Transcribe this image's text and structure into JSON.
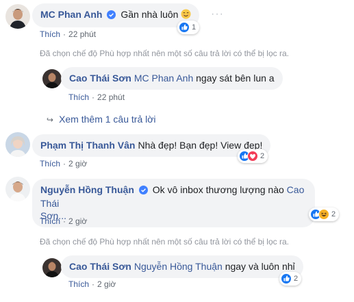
{
  "comments": [
    {
      "author": "MC Phan Anh",
      "verified": true,
      "text": "Gần nhà luôn",
      "emoji": "😊",
      "like_label": "Thích",
      "time": "22 phút",
      "reaction_count": "1"
    },
    {
      "author": "Phạm Thị Thanh Vân",
      "text": "Nhà đẹp! Bạn đẹp! View đẹp!",
      "like_label": "Thích",
      "time": "2 giờ",
      "reaction_count": "2"
    },
    {
      "author": "Nguyễn Hồng Thuận",
      "verified": true,
      "text_line1": "Ok vô inbox thương lượng nào",
      "mention_line1": "Cao Thái",
      "mention_line2": "Sơn...",
      "like_label": "Thích",
      "time": "2 giờ",
      "reaction_count": "2"
    }
  ],
  "replies": [
    {
      "author": "Cao Thái Sơn",
      "mention": "MC Phan Anh",
      "text": "ngay sát bên lun a",
      "like_label": "Thích",
      "time": "22 phút"
    },
    {
      "author": "Cao Thái Sơn",
      "mention": "Nguyễn Hồng Thuận",
      "text": "ngay và luôn nhỉ",
      "like_label": "Thích",
      "time": "2 giờ",
      "reaction_count": "2"
    }
  ],
  "filter_notice": "Đã chọn chế độ Phù hợp nhất nên một số câu trả lời có thể bị lọc ra.",
  "view_more_replies": "Xem thêm 1 câu trả lời",
  "more_options": "···",
  "colors": {
    "link": "#385898",
    "bubble": "#f2f3f5",
    "like": "#1877f2",
    "love": "#f33e58",
    "haha": "#f7b125"
  }
}
